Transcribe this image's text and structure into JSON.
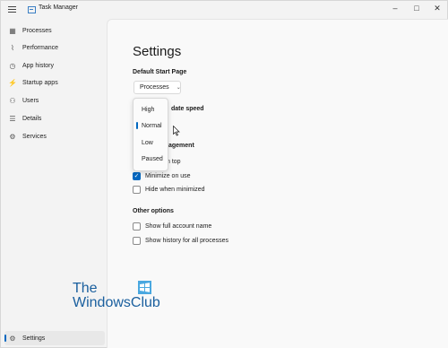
{
  "window": {
    "title": "Task Manager",
    "controls": {
      "minimize": "–",
      "maximize": "□",
      "close": "✕"
    }
  },
  "sidebar": {
    "items": [
      {
        "label": "Processes",
        "icon": "processes-icon",
        "active": false
      },
      {
        "label": "Performance",
        "icon": "performance-icon",
        "active": false
      },
      {
        "label": "App history",
        "icon": "history-icon",
        "active": false
      },
      {
        "label": "Startup apps",
        "icon": "startup-icon",
        "active": false
      },
      {
        "label": "Users",
        "icon": "users-icon",
        "active": false
      },
      {
        "label": "Details",
        "icon": "details-icon",
        "active": false
      },
      {
        "label": "Services",
        "icon": "services-icon",
        "active": false
      }
    ],
    "settings": {
      "label": "Settings",
      "icon": "gear-icon",
      "active": true
    }
  },
  "main": {
    "heading": "Settings",
    "default_start_page": {
      "label": "Default Start Page",
      "selected": "Processes"
    },
    "update_speed": {
      "label_partial": "date speed",
      "options": [
        "High",
        "Normal",
        "Low",
        "Paused"
      ],
      "selected": "Normal"
    },
    "window_management": {
      "label_partial": "agement",
      "items": [
        {
          "label": "n top",
          "checked": false
        },
        {
          "label": "Minimize on use",
          "checked": true
        },
        {
          "label": "Hide when minimized",
          "checked": false
        }
      ]
    },
    "other_options": {
      "label": "Other options",
      "items": [
        {
          "label": "Show full account name",
          "checked": false
        },
        {
          "label": "Show history for all processes",
          "checked": false
        }
      ]
    }
  },
  "watermark": {
    "line1": "The",
    "line2": "WindowsClub"
  },
  "colors": {
    "accent": "#0067c0",
    "sidebar_bg": "#f3f3f3",
    "content_bg": "#f9f9f9"
  }
}
